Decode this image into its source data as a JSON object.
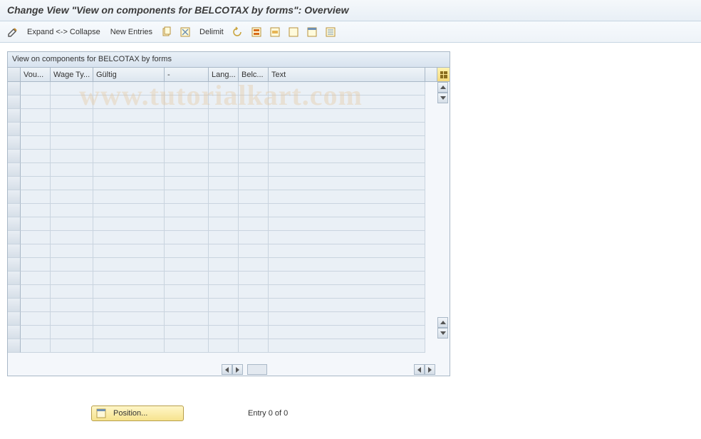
{
  "title": "Change View \"View on components for BELCOTAX by forms\": Overview",
  "toolbar": {
    "expand_collapse": "Expand <-> Collapse",
    "new_entries": "New Entries",
    "delimit": "Delimit"
  },
  "panel": {
    "title": "View on components for BELCOTAX by forms"
  },
  "columns": {
    "c1": "Vou...",
    "c2": "Wage Ty...",
    "c3": "Gültig",
    "c4": "-",
    "c5": "Lang...",
    "c6": "Belc...",
    "c7": "Text"
  },
  "footer": {
    "position": "Position...",
    "entry": "Entry 0 of 0"
  },
  "watermark": "www.tutorialkart.com"
}
